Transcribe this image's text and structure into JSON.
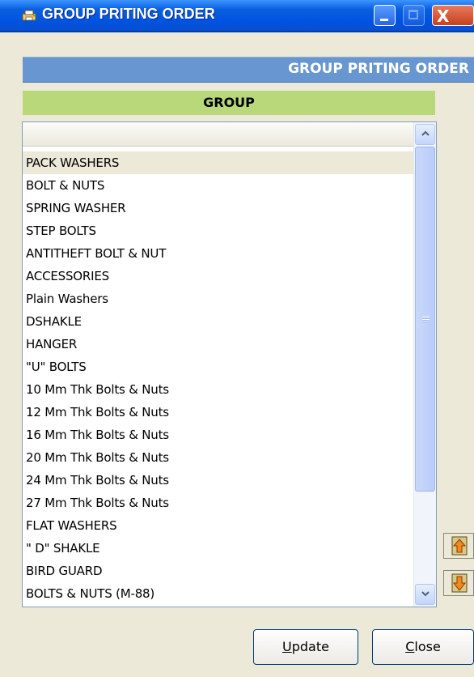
{
  "window": {
    "title": "GROUP PRITING ORDER",
    "title_icon": "printer-app-icon"
  },
  "titlebar_buttons": {
    "minimize_icon": "minimize-icon",
    "maximize_icon": "maximize-icon",
    "close_icon": "close-icon",
    "close_glyph": "X"
  },
  "header": {
    "banner_text": "GROUP PRITING ORDER"
  },
  "group": {
    "heading": "GROUP"
  },
  "list": {
    "items": [
      "PACK WASHERS",
      "BOLT & NUTS",
      "SPRING WASHER",
      "STEP BOLTS",
      "ANTITHEFT BOLT & NUT",
      "ACCESSORIES",
      "Plain Washers",
      "DSHAKLE",
      "HANGER",
      "\"U\" BOLTS",
      "10 Mm Thk Bolts & Nuts",
      "12 Mm Thk Bolts & Nuts",
      "16 Mm Thk Bolts & Nuts",
      "20 Mm Thk Bolts & Nuts",
      "24 Mm Thk Bolts & Nuts",
      "27 Mm Thk Bolts & Nuts",
      "FLAT WASHERS",
      "\" D\" SHAKLE",
      "BIRD GUARD",
      "BOLTS & NUTS (M-88)"
    ],
    "selected": "PACK WASHERS"
  },
  "side_buttons": {
    "move_up_icon": "move-up-icon",
    "move_down_icon": "move-down-icon"
  },
  "buttons": {
    "update_accel": "U",
    "update_rest": "pdate",
    "close_accel": "C",
    "close_rest": "lose"
  },
  "colors": {
    "titlebar": "#0053e1",
    "header_banner": "#6896d0",
    "group_heading": "#b8d87a",
    "window_bg": "#ece9d8"
  }
}
